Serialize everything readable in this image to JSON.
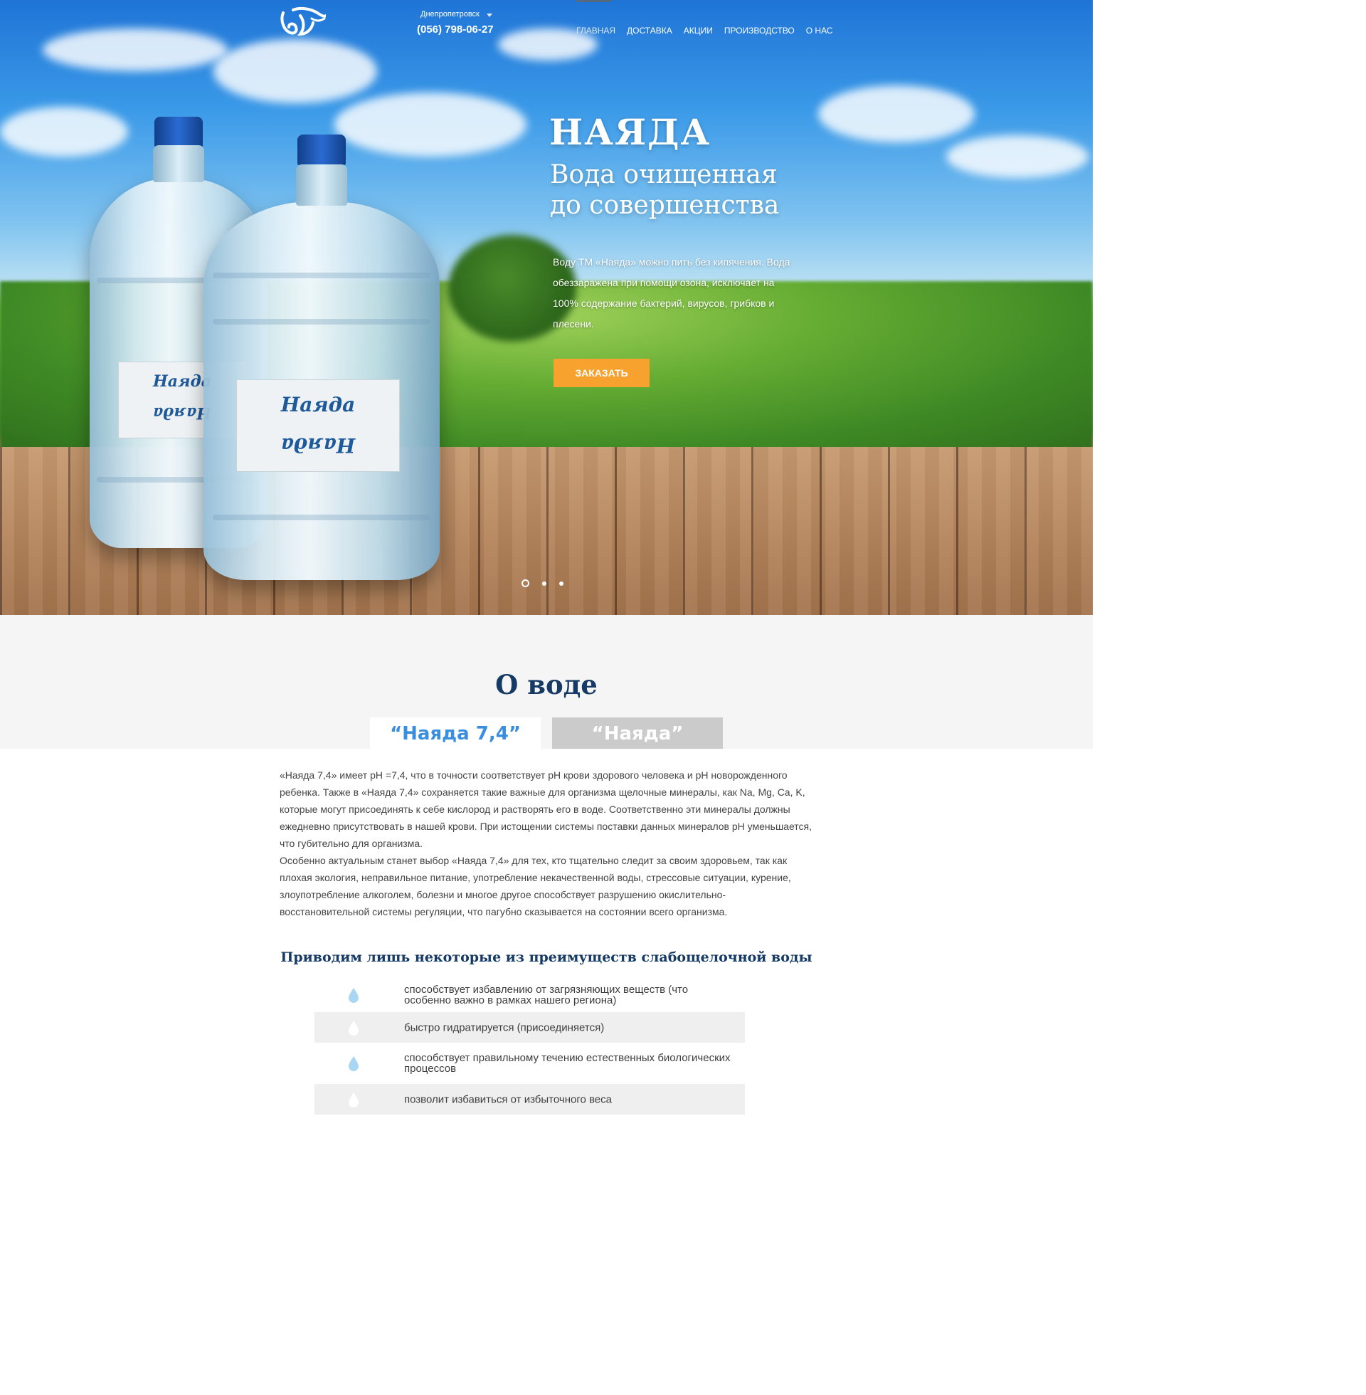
{
  "header": {
    "city": "Днепропетровск",
    "phone": "(056) 798-06-27",
    "nav": [
      {
        "label": "Главная",
        "active": true
      },
      {
        "label": "Доставка",
        "active": false
      },
      {
        "label": "Акции",
        "active": false
      },
      {
        "label": "Производство",
        "active": false
      },
      {
        "label": "О нас",
        "active": false
      }
    ]
  },
  "hero": {
    "brand": "НАЯДА",
    "tagline_line1": "Вода очищенная",
    "tagline_line2": "до совершенства",
    "description": "Воду ТМ «Наяда» можно пить без кипячения. Вода обеззаражена при помощи озона, исключает на 100% содержание бактерий, вирусов, грибков и плесени.",
    "order_button": "Заказать",
    "slider": {
      "total": 3,
      "active": 1
    },
    "bottle_label": "Наяда",
    "accent_color": "#f7a12e"
  },
  "about": {
    "title": "О воде",
    "tabs": [
      {
        "label": "“Наяда 7,4”",
        "active": true
      },
      {
        "label": "“Наяда”",
        "active": false
      }
    ],
    "paragraph1": "«Наяда 7,4» имеет pH =7,4, что в точности соответствует pH крови здорового человека и pH новорожденного ребенка. Также в «Наяда 7,4» сохраняется такие важные для организма щелочные минералы, как Na, Mg, Ca, K,  которые могут присоединять к себе кислород и растворять его в воде. Соответственно эти минералы должны ежедневно присутствовать в нашей крови. При истощении системы поставки данных минералов pH уменьшается, что губительно для организма.",
    "paragraph2": "Особенно актуальным станет выбор «Наяда 7,4» для тех, кто тщательно следит за своим здоровьем, так как плохая экология, неправильное питание, употребление некачественной воды, стрессовые ситуации, курение, злоупотребление алкоголем, болезни и многое другое способствует разрушению окислительно-восстановительной системы регуляции, что пагубно сказывается на состоянии всего организма.",
    "benefits_title": "Приводим лишь некоторые из преимуществ слабощелочной воды",
    "benefits": [
      "способствует избавлению от загрязняющих веществ (что особенно важно в рамках  нашего региона)",
      "быстро гидратируется (присоединяется)",
      "способствует правильному течению естественных биологических процессов",
      "позволит избавиться от избыточного веса"
    ],
    "drop_icon": "water-drop-icon",
    "title_color": "#153a66",
    "tab_active_color": "#3a8ee0"
  }
}
